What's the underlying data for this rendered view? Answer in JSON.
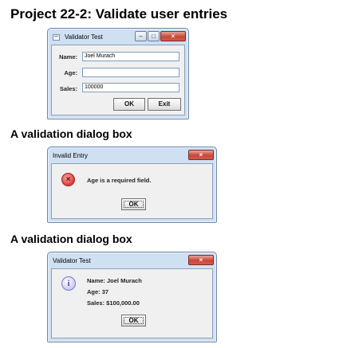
{
  "headings": {
    "main": "Project 22-2: Validate user entries",
    "dialog1": "A validation dialog box",
    "dialog2": "A validation dialog box"
  },
  "validator_window": {
    "title": "Validator Test",
    "fields": {
      "name_label": "Name:",
      "name_value": "Joel Murach",
      "age_label": "Age:",
      "age_value": "",
      "sales_label": "Sales:",
      "sales_value": "100000"
    },
    "ok_label": "OK",
    "exit_label": "Exit"
  },
  "error_dialog": {
    "title": "Invalid Entry",
    "message": "Age is a required field.",
    "ok_label": "OK"
  },
  "info_dialog": {
    "title": "Validator Test",
    "line1": "Name: Joel Murach",
    "line2": "Age: 37",
    "line3": "Sales: $100,000.00",
    "ok_label": "OK"
  },
  "icons": {
    "error": "error-icon",
    "info": "info-icon",
    "app": "java-app-icon"
  },
  "colors": {
    "frame": "#cfe0f3",
    "close_button": "#c8473a",
    "field_border": "#7f9db9"
  }
}
